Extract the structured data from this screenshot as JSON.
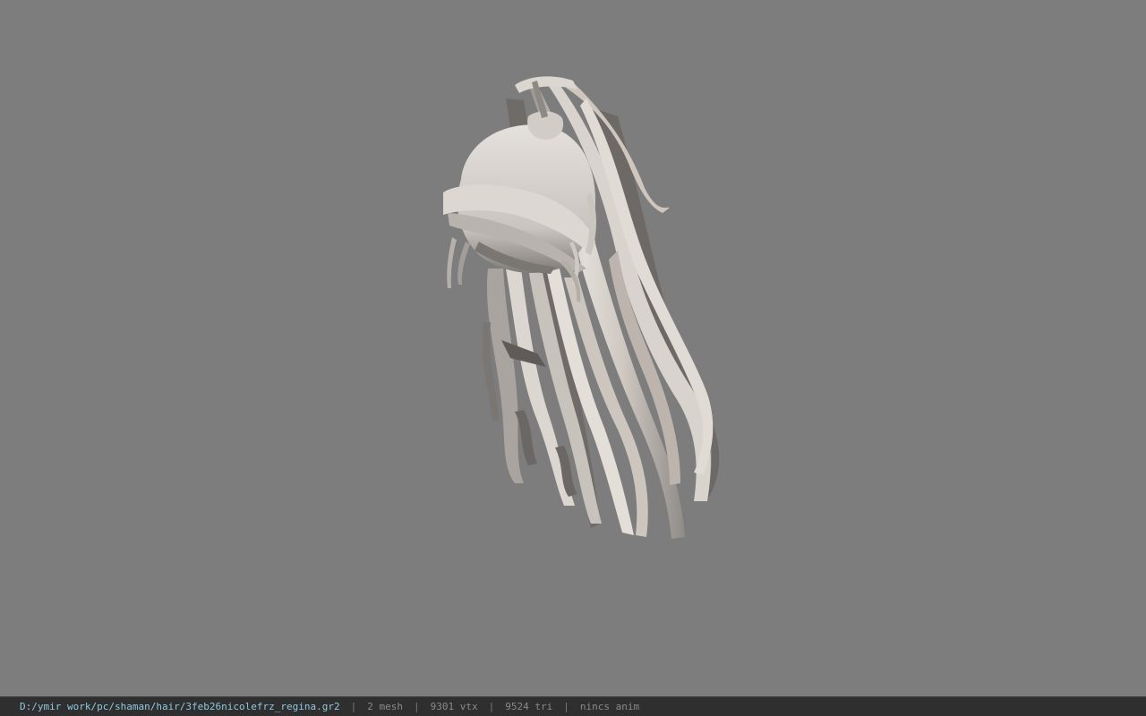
{
  "viewport": {
    "background": "#7d7d7d",
    "model_name": "hair-model",
    "hair_color": "#d8d2cc"
  },
  "status": {
    "path": "D:/ymir work/pc/shaman/hair/3feb26nicolefrz_regina.gr2",
    "separator": "|",
    "mesh": "2 mesh",
    "vtx": "9301 vtx",
    "tri": "9524 tri",
    "anim": "nincs anim"
  }
}
